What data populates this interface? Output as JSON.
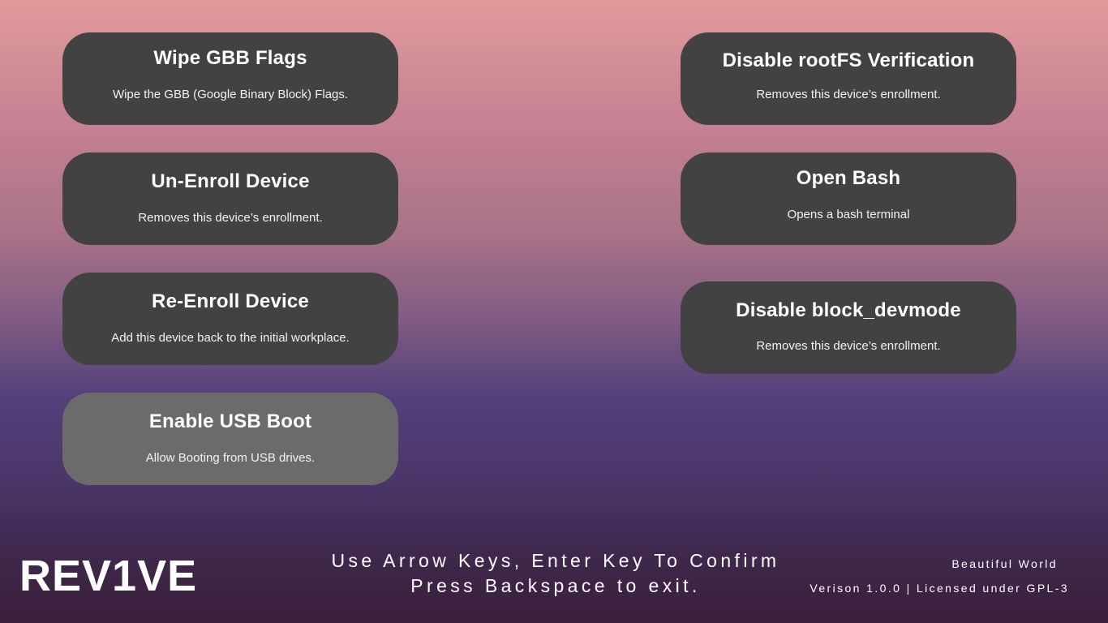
{
  "menu": {
    "left": [
      {
        "title": "Wipe GBB Flags",
        "description": "Wipe the GBB (Google Binary Block) Flags."
      },
      {
        "title": "Un-Enroll Device",
        "description": "Removes this device’s enrollment."
      },
      {
        "title": "Re-Enroll Device",
        "description": "Add this device back to the initial workplace."
      },
      {
        "title": "Enable USB Boot",
        "description": "Allow Booting from USB drives."
      }
    ],
    "right": [
      {
        "title": "Disable rootFS Verification",
        "description": "Removes this device’s enrollment."
      },
      {
        "title": "Open Bash",
        "description": "Opens a bash terminal"
      },
      {
        "title": "Disable block_devmode",
        "description": "Removes this device’s enrollment."
      }
    ],
    "selected": "Enable USB Boot"
  },
  "footer": {
    "logo": "REV1VE",
    "instructions_line1": "Use Arrow Keys, Enter Key To Confirm",
    "instructions_line2": "Press Backspace to exit.",
    "tagline": "Beautiful World",
    "version": "Verison 1.0.0 | Licensed under GPL-3"
  },
  "colors": {
    "card": "#424242",
    "card_selected": "#6b6b6b",
    "text": "#ffffff"
  }
}
